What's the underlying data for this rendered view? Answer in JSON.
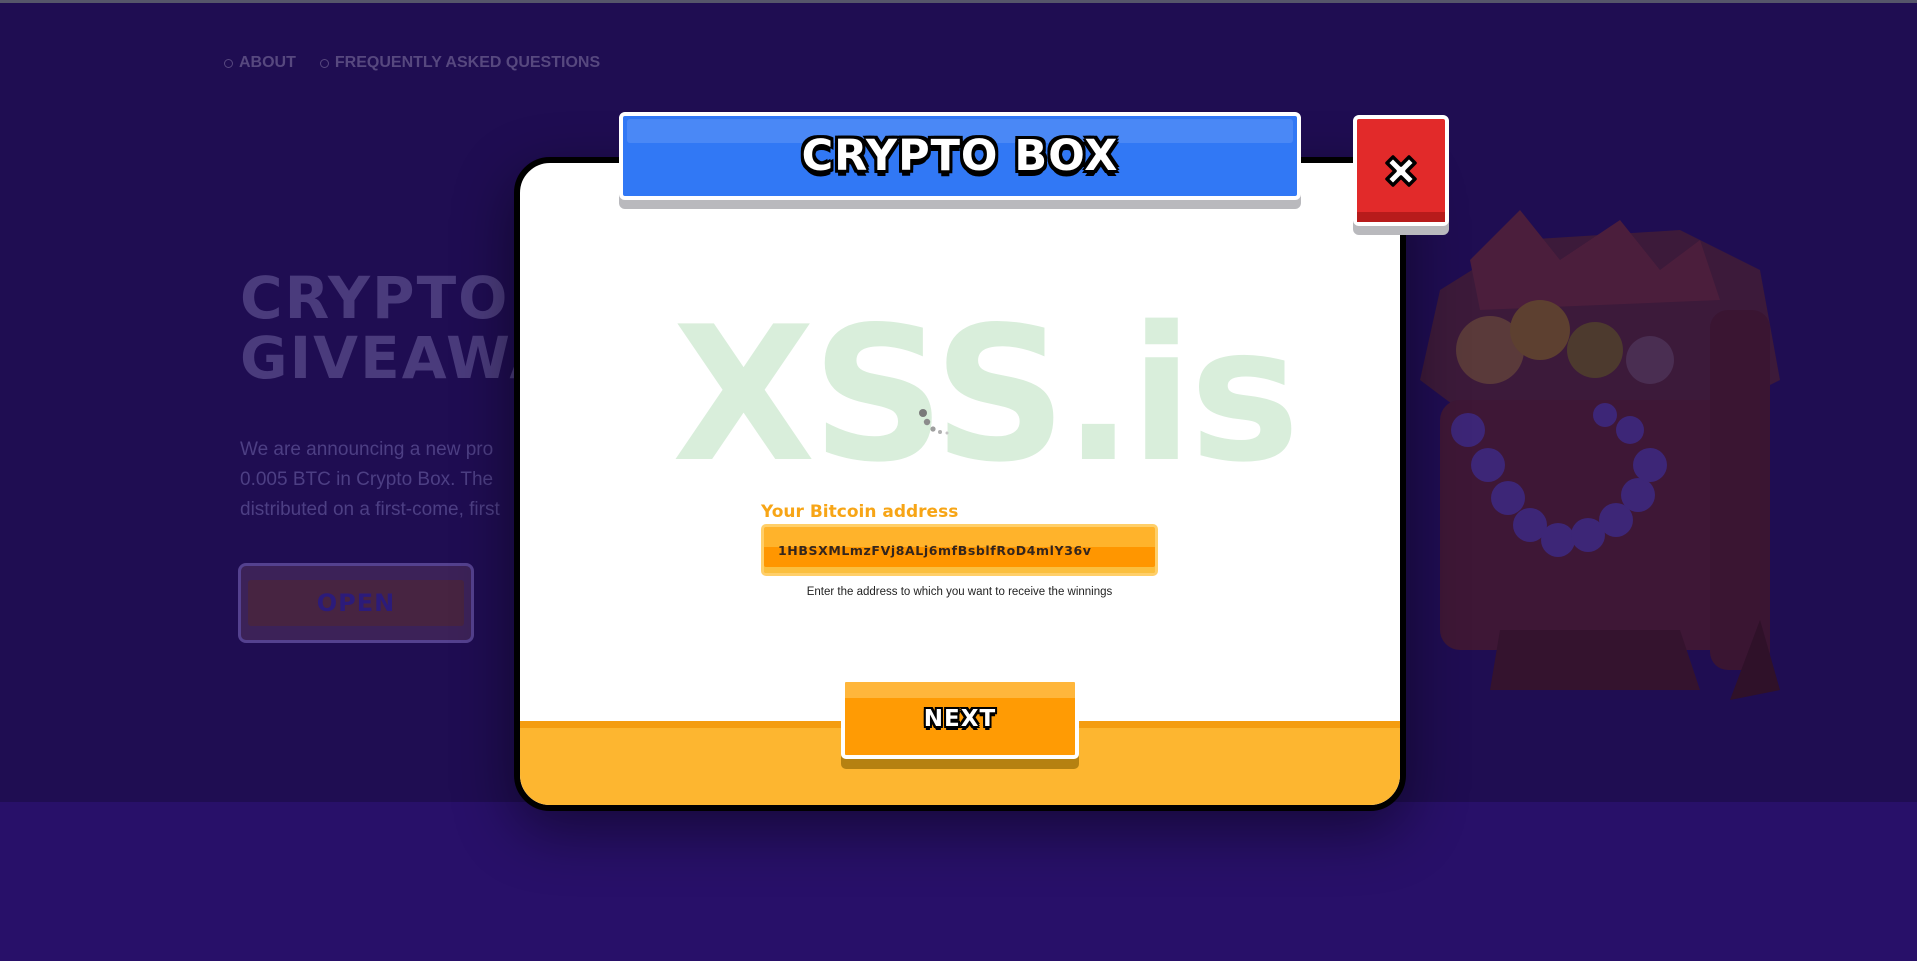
{
  "nav": {
    "items": [
      {
        "label": "ABOUT"
      },
      {
        "label": "FREQUENTLY ASKED QUESTIONS"
      }
    ]
  },
  "hero": {
    "title_line1": "CRYPTO",
    "title_line2": "GIVEAWA",
    "text_lines": [
      "We are announcing a new pro",
      "0.005 BTC in Crypto Box. The",
      "distributed on a first-come, first"
    ],
    "open_label": "OPEN"
  },
  "modal": {
    "title": "CRYPTO BOX",
    "watermark": "XSS.is",
    "address_label": "Your Bitcoin address",
    "address_value": "1HBSXMLmzFVj8ALj6mfBsblfRoD4mlY36v",
    "address_hint": "Enter the address to which you want to receive the winnings",
    "next_label": "NEXT"
  },
  "icons": {
    "close": "close-x-icon",
    "loading": "spinner-icon",
    "chest": "treasure-chest-image"
  },
  "colors": {
    "background": "#1f0d52",
    "banner_blue": "#3178f5",
    "close_red": "#e22a2a",
    "accent_orange": "#ff9b04",
    "footer_yellow": "#fdb630"
  }
}
